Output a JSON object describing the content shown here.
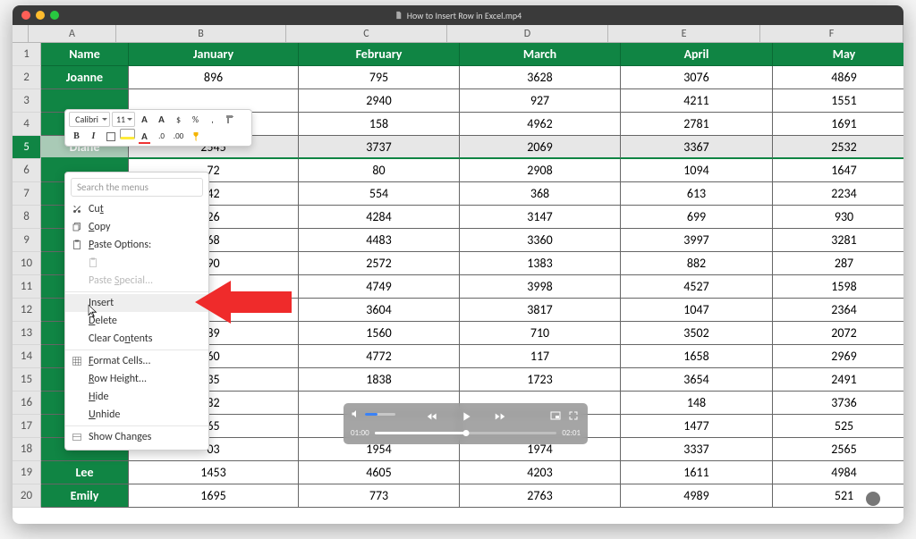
{
  "window": {
    "title": "How to Insert Row in Excel.mp4"
  },
  "columns": [
    "A",
    "B",
    "C",
    "D",
    "E",
    "F"
  ],
  "header_row": [
    "Name",
    "January",
    "February",
    "March",
    "April",
    "May"
  ],
  "rows": [
    {
      "n": 2,
      "name": "Joanne",
      "vals": [
        896,
        795,
        3628,
        3076,
        4869
      ]
    },
    {
      "n": 3,
      "name": "",
      "vals": [
        "",
        2940,
        927,
        4211,
        1551
      ]
    },
    {
      "n": 4,
      "name": "",
      "vals": [
        158,
        4962,
        2781,
        1691
      ],
      "partial_b": ""
    },
    {
      "n": 5,
      "name": "Diane",
      "vals": [
        2545,
        3737,
        2069,
        3367,
        2532
      ],
      "selected": true
    },
    {
      "n": 6,
      "name": "",
      "vals": [
        "72",
        80,
        2908,
        1094,
        1647
      ]
    },
    {
      "n": 7,
      "name": "",
      "vals": [
        "42",
        554,
        368,
        613,
        2234
      ]
    },
    {
      "n": 8,
      "name": "",
      "vals": [
        "26",
        4284,
        3147,
        699,
        930
      ]
    },
    {
      "n": 9,
      "name": "",
      "vals": [
        "68",
        4483,
        3360,
        3997,
        3281
      ]
    },
    {
      "n": 10,
      "name": "",
      "vals": [
        "90",
        2572,
        1383,
        882,
        287
      ]
    },
    {
      "n": 11,
      "name": "",
      "vals": [
        "",
        4749,
        3998,
        4527,
        1598
      ]
    },
    {
      "n": 12,
      "name": "",
      "vals": [
        "",
        3604,
        3817,
        1047,
        2364
      ]
    },
    {
      "n": 13,
      "name": "",
      "vals": [
        "89",
        1560,
        710,
        3502,
        2072
      ]
    },
    {
      "n": 14,
      "name": "",
      "vals": [
        "60",
        4772,
        117,
        1658,
        2969
      ]
    },
    {
      "n": 15,
      "name": "",
      "vals": [
        "35",
        1838,
        1723,
        3654,
        2491
      ]
    },
    {
      "n": 16,
      "name": "",
      "vals": [
        "82",
        "",
        "",
        148,
        3736
      ]
    },
    {
      "n": 17,
      "name": "",
      "vals": [
        "65",
        "",
        "",
        1477,
        525
      ]
    },
    {
      "n": 18,
      "name": "",
      "vals": [
        "03",
        1954,
        1974,
        3337,
        2565
      ]
    },
    {
      "n": 19,
      "name": "Lee",
      "vals": [
        1453,
        4605,
        4203,
        1611,
        4984
      ]
    },
    {
      "n": 20,
      "name": "Emily",
      "vals": [
        1695,
        773,
        2763,
        4989,
        521
      ]
    }
  ],
  "mini_toolbar": {
    "font": "Calibri",
    "size": "11",
    "a_label": "A",
    "a_small": "A",
    "percent": "%",
    "comma": ",",
    "b": "B",
    "i": "I"
  },
  "context_menu": {
    "search_placeholder": "Search the menus",
    "cut": "Cut",
    "copy": "Copy",
    "paste_options": "Paste Options:",
    "paste_special": "Paste Special...",
    "insert": "Insert",
    "delete": "Delete",
    "clear": "Clear Contents",
    "format": "Format Cells...",
    "row_height": "Row Height...",
    "hide": "Hide",
    "unhide": "Unhide",
    "show_changes": "Show Changes"
  },
  "media": {
    "t_left": "01:00",
    "t_right": "02:01"
  }
}
